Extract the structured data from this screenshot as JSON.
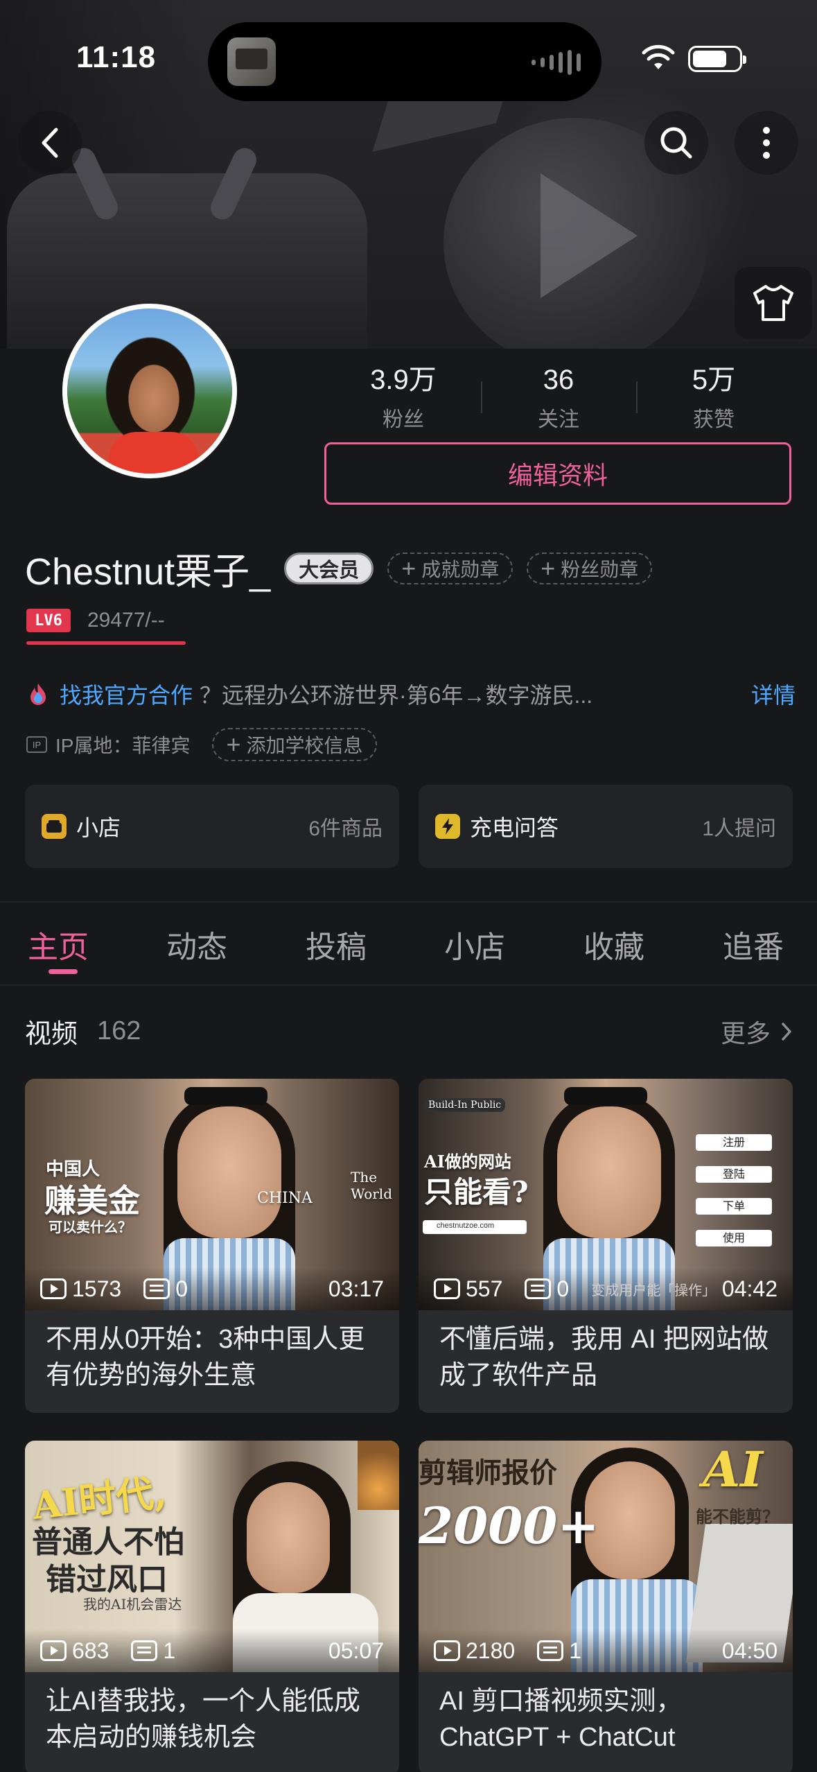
{
  "status_bar": {
    "time": "11:18"
  },
  "profile": {
    "stats": [
      {
        "value": "3.9万",
        "label": "粉丝"
      },
      {
        "value": "36",
        "label": "关注"
      },
      {
        "value": "5万",
        "label": "获赞"
      }
    ],
    "edit_button": "编辑资料",
    "name": "Chestnut栗子_",
    "vip_badge": "大会员",
    "achievement_medal": "成就勋章",
    "fan_medal": "粉丝勋章",
    "level_label": "LV6",
    "level_exp": "29477/--",
    "official_link": "找我官方合作",
    "bio": "？远程办公环游世界·第6年→数字游民...",
    "detail_link": "详情",
    "ip_location": "IP属地：菲律宾",
    "add_school": "添加学校信息"
  },
  "cards": [
    {
      "title": "小店",
      "sub": "6件商品"
    },
    {
      "title": "充电问答",
      "sub": "1人提问"
    }
  ],
  "tabs": [
    "主页",
    "动态",
    "投稿",
    "小店",
    "收藏",
    "追番"
  ],
  "section": {
    "title": "视频",
    "count": "162",
    "more": "更多"
  },
  "videos": [
    {
      "views": "1573",
      "danmaku": "0",
      "duration": "03:17",
      "title": "不用从0开始：3种中国人更有优势的海外生意",
      "overlay": {
        "line1": "中国人",
        "line2": "赚美金",
        "line3": "可以卖什么？",
        "china": "CHINA",
        "world": "The World"
      }
    },
    {
      "views": "557",
      "danmaku": "0",
      "duration": "04:42",
      "title": "不懂后端，我用 AI 把网站做成了软件产品",
      "overlay": {
        "tag": "Build-In Public",
        "line1": "AI做的网站",
        "line2": "只能看?",
        "url": "chestnutzoe.com",
        "buttons": [
          "注册",
          "登陆",
          "下单",
          "使用"
        ],
        "caption": "变成用户能「操作」"
      }
    },
    {
      "views": "683",
      "danmaku": "1",
      "duration": "05:07",
      "title": "让AI替我找，一个人能低成本启动的赚钱机会",
      "overlay": {
        "line1": "AI时代,",
        "line2": "普通人不怕",
        "line3": "错过风口",
        "line4": "我的AI机会雷达"
      }
    },
    {
      "views": "2180",
      "danmaku": "1",
      "duration": "04:50",
      "title": "AI 剪口播视频实测，ChatGPT + ChatCut",
      "overlay": {
        "line1": "剪辑师报价",
        "line2": "2000+",
        "line3": "AI",
        "line4": "能不能剪？"
      }
    }
  ]
}
